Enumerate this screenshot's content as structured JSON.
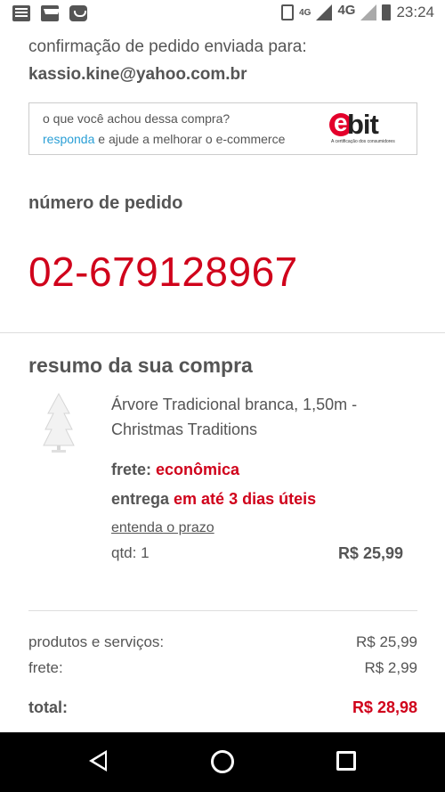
{
  "status_bar": {
    "time": "23:24",
    "network_small": "4G",
    "network_large": "4G"
  },
  "confirmation": {
    "label": "confirmação de pedido enviada para:",
    "email": "kassio.kine@yahoo.com.br"
  },
  "ebit": {
    "question": "o que você achou dessa compra?",
    "link_text": "responda",
    "rest_text": " e ajude a melhorar o e-commerce",
    "logo_text": "bit",
    "logo_tagline": "A certificação dos consumidores"
  },
  "order": {
    "label": "número de pedido",
    "number": "02-679128967"
  },
  "summary": {
    "title": "resumo da sua compra",
    "product_name": "Árvore Tradicional branca, 1,50m - Christmas Traditions",
    "frete_label": "frete: ",
    "frete_value": "econômica",
    "entrega_label": "entrega ",
    "entrega_value": "em até 3 dias úteis",
    "prazo_link": "entenda o prazo",
    "qtd": "qtd: 1",
    "price": "R$ 25,99"
  },
  "totals": {
    "produtos_label": "produtos e serviços:",
    "produtos_value": "R$ 25,99",
    "frete_label": "frete:",
    "frete_value": "R$ 2,99",
    "total_label": "total:",
    "total_value": "R$ 28,98"
  },
  "colors": {
    "accent_red": "#d0021b",
    "link_blue": "#2a9fd6"
  }
}
